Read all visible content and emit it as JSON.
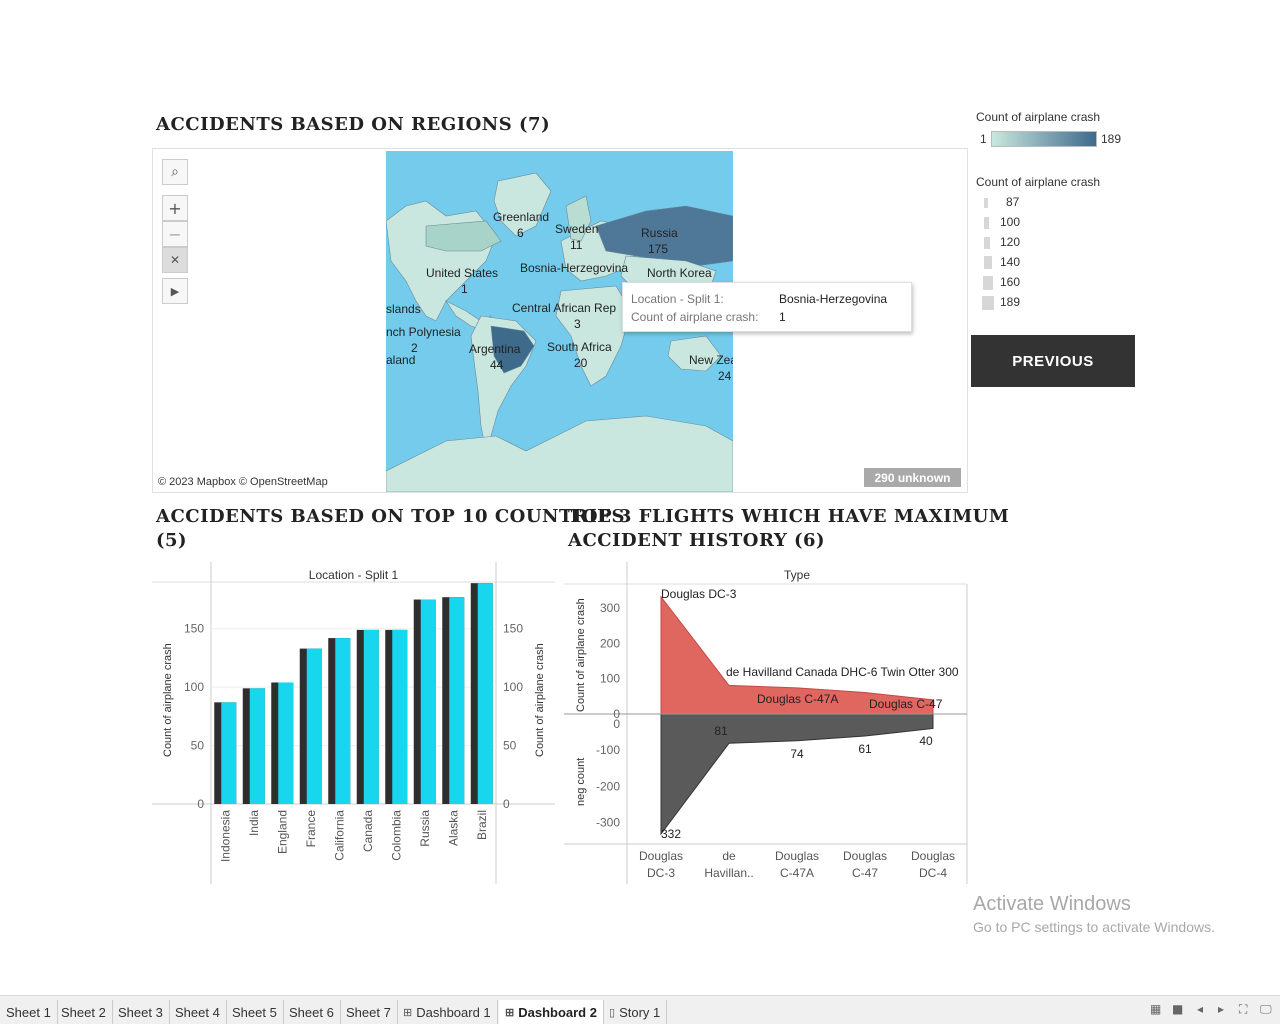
{
  "dashboard": {
    "map_title": "Accidents based on Regions (7)",
    "bar_title_line1": "Accidents based on Top 10 countries",
    "bar_title_line2": "(5)",
    "area_title_line1": "Top 3 Flights which have Maximum",
    "area_title_line2": "accident history (6)"
  },
  "map": {
    "attribution": "© 2023 Mapbox © OpenStreetMap",
    "unknown_badge": "290 unknown",
    "tools": {
      "search_icon": "search-icon",
      "zoom_in": "+",
      "zoom_out": "−",
      "pin_icon": "pin-icon",
      "expand_icon": "play-icon"
    },
    "labels": [
      {
        "name": "Greenland",
        "value": "6"
      },
      {
        "name": "Sweden",
        "value": "11"
      },
      {
        "name": "Russia",
        "value": "175"
      },
      {
        "name": "United States",
        "value": "1"
      },
      {
        "name": "Bosnia-Herzegovina",
        "value": ""
      },
      {
        "name": "North Korea",
        "value": ""
      },
      {
        "name": "slands",
        "value": ""
      },
      {
        "name": "Central African Rep",
        "value": "3"
      },
      {
        "name": "nch Polynesia",
        "value": "2"
      },
      {
        "name": "Argentina",
        "value": "44"
      },
      {
        "name": "South Africa",
        "value": "20"
      },
      {
        "name": "New Zea",
        "value": "24"
      },
      {
        "name": "aland",
        "value": ""
      }
    ],
    "colors": {
      "ocean": "#74cbec",
      "land_low": "#c9e7de",
      "land_high": "#3e6a8c",
      "land_mid": "#5b87a6"
    }
  },
  "tooltip": {
    "key1": "Location - Split 1:",
    "val1": "Bosnia-Herzegovina",
    "key2": "Count of airplane crash:",
    "val2": "1"
  },
  "legend": {
    "color_title": "Count of airplane crash",
    "color_min": "1",
    "color_max": "189",
    "size_title": "Count of airplane crash",
    "size_items": [
      "87",
      "100",
      "120",
      "140",
      "160",
      "189"
    ]
  },
  "buttons": {
    "previous": "PREVIOUS"
  },
  "chart_data": [
    {
      "type": "bar",
      "header": "Location - Split 1",
      "ylabel": "Count of airplane crash",
      "ylim": [
        0,
        190
      ],
      "yticks": [
        0,
        50,
        100,
        150
      ],
      "categories": [
        "Indonesia",
        "India",
        "England",
        "France",
        "California",
        "Canada",
        "Colombia",
        "Russia",
        "Alaska",
        "Brazil"
      ],
      "series": [
        {
          "values": [
            87,
            99,
            104,
            133,
            142,
            149,
            149,
            175,
            177,
            189
          ],
          "color": "#2e2e2e"
        },
        {
          "values": [
            87,
            99,
            104,
            133,
            142,
            149,
            149,
            175,
            177,
            189
          ],
          "color": "#17d6ee"
        }
      ]
    },
    {
      "type": "area",
      "header": "Type",
      "ylabel_top": "Count of airplane crash",
      "ylabel_bottom": "neg count",
      "yticks_top": [
        0,
        100,
        200,
        300
      ],
      "yticks_bottom": [
        0,
        -100,
        -200,
        -300
      ],
      "categories": [
        "Douglas DC-3",
        "de Havillan..",
        "Douglas C-47A",
        "Douglas C-47",
        "Douglas DC-4"
      ],
      "category_lines": [
        [
          "Douglas",
          "DC-3"
        ],
        [
          "de",
          "Havillan.."
        ],
        [
          "Douglas",
          "C-47A"
        ],
        [
          "Douglas",
          "C-47"
        ],
        [
          "Douglas",
          "DC-4"
        ]
      ],
      "series": [
        {
          "name": "Count of airplane crash",
          "values": [
            332,
            81,
            74,
            61,
            40
          ],
          "color": "#e06660"
        },
        {
          "name": "neg count",
          "values": [
            -332,
            -81,
            -74,
            -61,
            -40
          ],
          "color": "#5a5a5a"
        }
      ],
      "top_labels": [
        "Douglas DC-3",
        "de Havilland Canada DHC-6 Twin Otter 300",
        "Douglas C-47A",
        "Douglas C-47",
        ""
      ],
      "bottom_labels": [
        "332",
        "81",
        "74",
        "61",
        "40"
      ]
    }
  ],
  "tabs": [
    {
      "label": "Sheet 1",
      "icon": ""
    },
    {
      "label": "Sheet 2",
      "icon": ""
    },
    {
      "label": "Sheet 3",
      "icon": ""
    },
    {
      "label": "Sheet 4",
      "icon": ""
    },
    {
      "label": "Sheet 5",
      "icon": ""
    },
    {
      "label": "Sheet 6",
      "icon": ""
    },
    {
      "label": "Sheet 7",
      "icon": ""
    },
    {
      "label": "Dashboard 1",
      "icon": "grid-icon"
    },
    {
      "label": "Dashboard 2",
      "icon": "grid-icon"
    },
    {
      "label": "Story 1",
      "icon": "story-icon"
    }
  ],
  "watermark": {
    "line1": "Activate Windows",
    "line2": "Go to PC settings to activate Windows."
  }
}
